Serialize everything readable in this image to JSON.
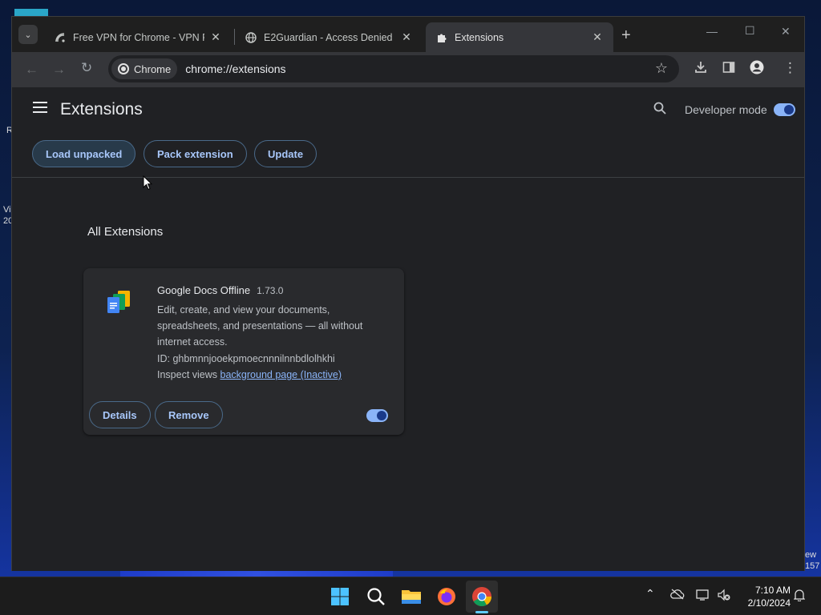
{
  "desktop": {
    "fragments": [
      "R",
      "Vi",
      "20",
      "ew",
      "157"
    ]
  },
  "tabs": [
    {
      "title": "Free VPN for Chrome - VPN Pro",
      "icon": "vpn-icon"
    },
    {
      "title": "E2Guardian - Access Denied",
      "icon": "globe-icon"
    },
    {
      "title": "Extensions",
      "icon": "puzzle-icon",
      "active": true
    }
  ],
  "toolbar": {
    "chip_label": "Chrome",
    "url": "chrome://extensions"
  },
  "page": {
    "title": "Extensions",
    "developer_mode_label": "Developer mode",
    "developer_mode_on": true,
    "buttons": {
      "load_unpacked": "Load unpacked",
      "pack_extension": "Pack extension",
      "update": "Update"
    },
    "section_title": "All Extensions"
  },
  "extension": {
    "name": "Google Docs Offline",
    "version": "1.73.0",
    "description": "Edit, create, and view your documents, spreadsheets, and presentations — all without internet access.",
    "id_label": "ID: ghbmnnjooekpmoecnnnilnnbdlolhkhi",
    "inspect_label": "Inspect views",
    "inspect_link": "background page (Inactive)",
    "details_label": "Details",
    "remove_label": "Remove",
    "enabled": true
  },
  "taskbar": {
    "time": "7:10 AM",
    "date": "2/10/2024"
  },
  "colors": {
    "accent": "#8ab4f8",
    "page_bg": "#202124",
    "card_bg": "#292a2d"
  }
}
